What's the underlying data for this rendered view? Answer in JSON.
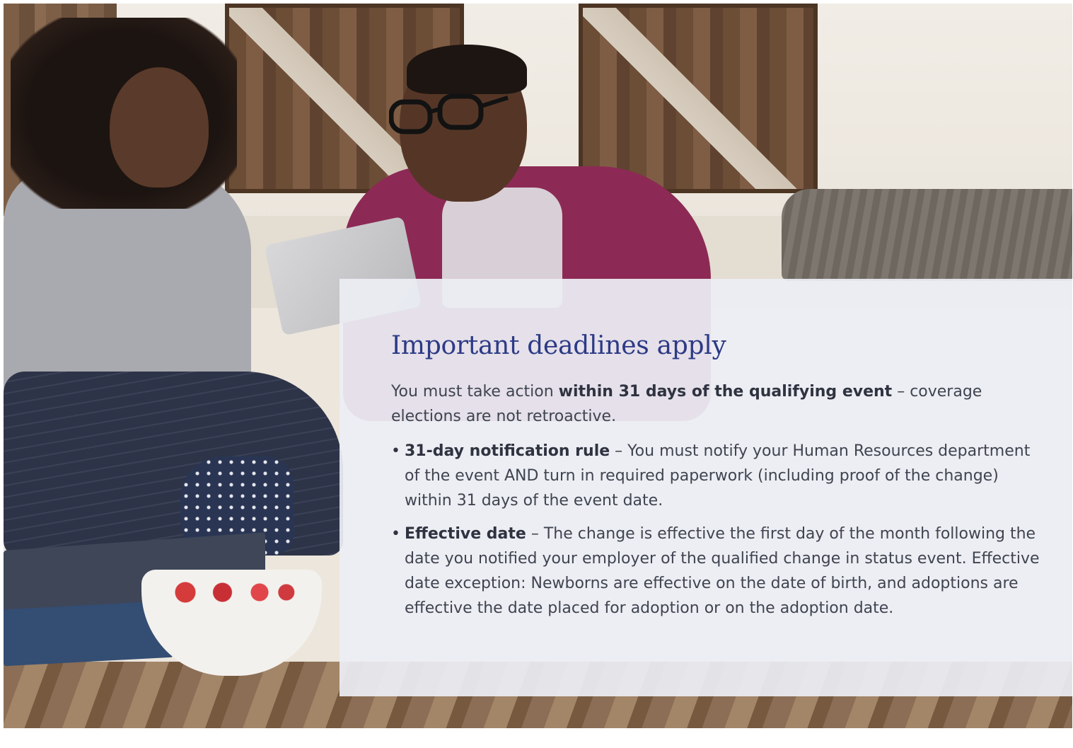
{
  "panel": {
    "title": "Important deadlines apply",
    "intro": {
      "prefix": "You must take action ",
      "bold": "within 31 days of the qualifying event",
      "suffix": " – coverage elections are not retroactive."
    },
    "bullets": [
      {
        "bold": "31-day notification rule",
        "text": " – You must notify your Human Resources department of the event AND turn in required paperwork (including proof of the change) within 31 days of the event date."
      },
      {
        "bold": "Effective date",
        "text": " – The change is effective the first day of the month following the date you notified your employer of the qualified change in status event. Effective date exception: Newborns are effective on the date of birth, and adoptions are effective the date placed for adoption or on the adoption date."
      }
    ]
  },
  "colors": {
    "title": "#2c3a86",
    "body_text": "#3f4450",
    "panel_bg": "#eceef4"
  }
}
